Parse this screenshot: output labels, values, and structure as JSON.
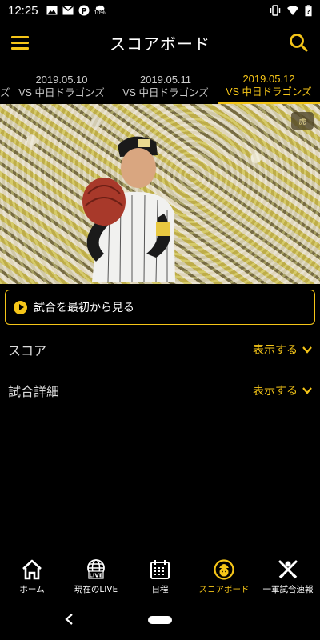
{
  "status_bar": {
    "time": "12:25",
    "left_icons": [
      "image-icon",
      "gmail-icon",
      "p-icon",
      "weather-icon"
    ],
    "weather_text": "10%",
    "right_icons": [
      "vibrate-icon",
      "wifi-icon",
      "battery-icon"
    ]
  },
  "header": {
    "title": "スコアボード"
  },
  "date_tabs": [
    {
      "date": "",
      "opponent": "ズ"
    },
    {
      "date": "2019.05.10",
      "opponent": "VS 中日ドラゴンズ"
    },
    {
      "date": "2019.05.11",
      "opponent": "VS 中日ドラゴンズ"
    },
    {
      "date": "2019.05.12",
      "opponent": "VS 中日ドラゴンズ",
      "active": true
    }
  ],
  "video": {
    "watermark": "虎"
  },
  "play_button": {
    "label": "試合を最初から見る"
  },
  "sections": {
    "score": {
      "label": "スコア",
      "toggle": "表示する"
    },
    "detail": {
      "label": "試合詳細",
      "toggle": "表示する"
    }
  },
  "bottom_nav": [
    {
      "label": "ホーム",
      "icon": "home-icon"
    },
    {
      "label": "現在のLIVE",
      "icon": "live-globe-icon",
      "badge": "LIVE"
    },
    {
      "label": "日程",
      "icon": "calendar-icon"
    },
    {
      "label": "スコアボード",
      "icon": "scoreboard-icon",
      "active": true
    },
    {
      "label": "一軍試合速報",
      "icon": "bat-ball-icon"
    }
  ],
  "colors": {
    "accent": "#f5c518",
    "background": "#000000"
  }
}
